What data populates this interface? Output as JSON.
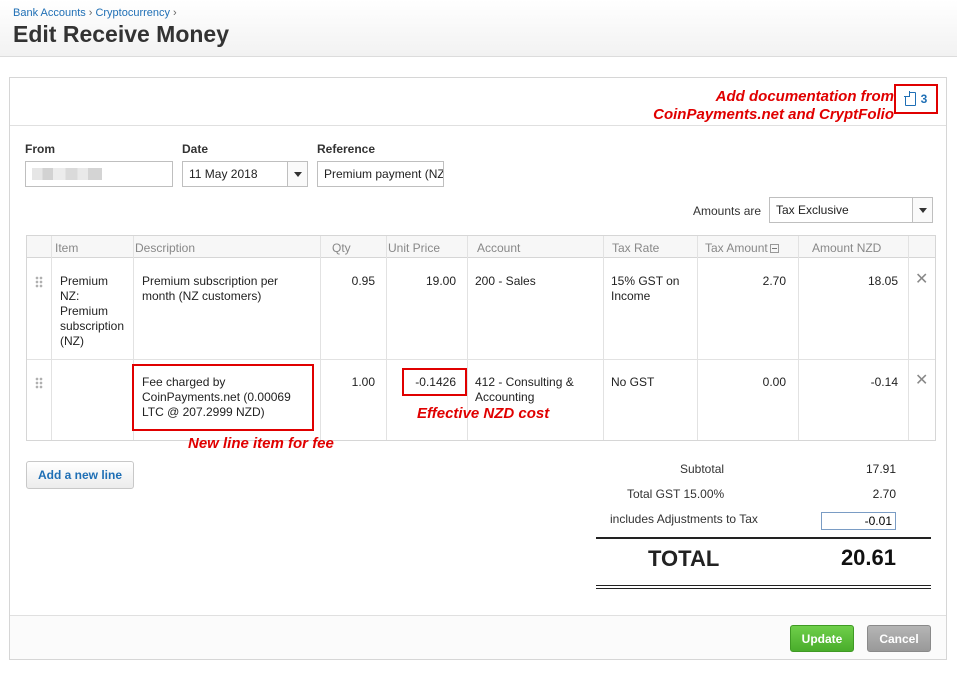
{
  "breadcrumb": {
    "items": [
      "Bank Accounts",
      "Cryptocurrency"
    ],
    "separator": "›"
  },
  "page": {
    "title": "Edit Receive Money"
  },
  "annotations": {
    "documentation": [
      "Add documentation from",
      "CoinPayments.net and CryptFolio"
    ],
    "new_line_fee": "New line item for fee",
    "effective_cost": "Effective NZD cost",
    "color": "#e00000"
  },
  "attachments": {
    "count": "3",
    "icon": "file-icon"
  },
  "form": {
    "from_label": "From",
    "date_label": "Date",
    "date_value": "11 May 2018",
    "reference_label": "Reference",
    "reference_value": "Premium payment (NZ",
    "amounts_label": "Amounts are",
    "amounts_value": "Tax Exclusive"
  },
  "table": {
    "headers": [
      "Item",
      "Description",
      "Qty",
      "Unit Price",
      "Account",
      "Tax Rate",
      "Tax Amount",
      "Amount NZD"
    ],
    "rows": [
      {
        "item": [
          "Premium",
          "NZ:",
          "Premium",
          "subscription",
          "(NZ)"
        ],
        "description": [
          "Premium subscription per",
          "month (NZ customers)"
        ],
        "qty": "0.95",
        "unit_price": "19.00",
        "account": [
          "200 - Sales"
        ],
        "tax_rate": [
          "15% GST on",
          "Income"
        ],
        "tax_amount": "2.70",
        "amount": "18.05"
      },
      {
        "item": [],
        "description": [
          "Fee charged by",
          "CoinPayments.net (0.00069",
          "LTC @ 207.2999 NZD)"
        ],
        "qty": "1.00",
        "unit_price": "-0.1426",
        "account": [
          "412 - Consulting &",
          "Accounting"
        ],
        "tax_rate": [
          "No GST"
        ],
        "tax_amount": "0.00",
        "amount": "-0.14"
      }
    ]
  },
  "buttons": {
    "add_line": "Add a new line",
    "update": "Update",
    "cancel": "Cancel"
  },
  "totals": {
    "subtotal_label": "Subtotal",
    "subtotal_value": "17.91",
    "gst_label": "Total GST 15.00%",
    "gst_value": "2.70",
    "adjust_label": "includes Adjustments to Tax",
    "adjust_value": "-0.01",
    "total_label": "TOTAL",
    "total_value": "20.61"
  },
  "colors": {
    "link": "#1f6fb5",
    "update": "#49ad2b",
    "cancel": "#999999"
  }
}
